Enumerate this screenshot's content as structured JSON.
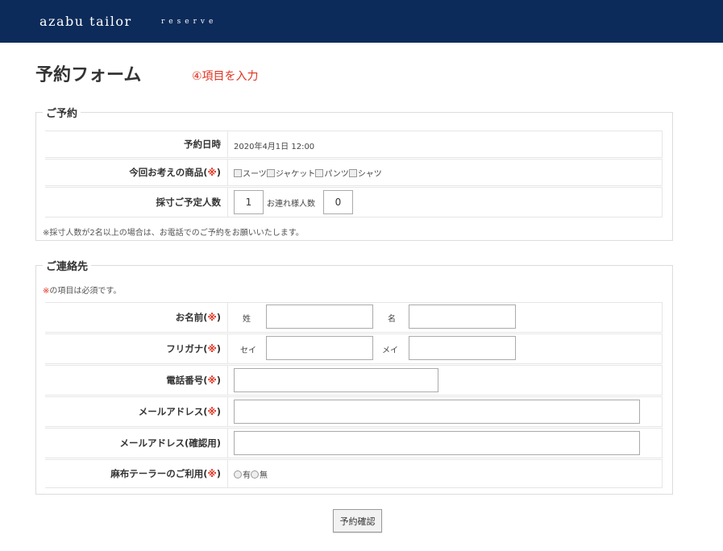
{
  "header": {
    "brand": "azabu tailor",
    "tagline": "reserve"
  },
  "page": {
    "title": "予約フォーム",
    "step_note": "④項目を入力"
  },
  "reservation": {
    "legend": "ご予約",
    "date_label": "予約日時",
    "date_value": "2020年4月1日 12:00",
    "products_label": "今回お考えの商品",
    "products": [
      "スーツ",
      "ジャケット",
      "パンツ",
      "シャツ"
    ],
    "count_label": "採寸ご予定人数",
    "count_value": "1",
    "companions_label": "お連れ様人数",
    "companions_value": "0",
    "note": "※採寸人数が2名以上の場合は、お電話でのご予約をお願いいたします。"
  },
  "contact": {
    "legend": "ご連絡先",
    "required_mark": "※",
    "required_note": "の項目は必須です。",
    "name_label": "お名前",
    "sei_label": "姓",
    "mei_label": "名",
    "kana_label": "フリガナ",
    "kana_sei_label": "セイ",
    "kana_mei_label": "メイ",
    "phone_label": "電話番号",
    "email_label": "メールアドレス",
    "email_confirm_label": "メールアドレス(確認用)",
    "usage_label": "麻布テーラーのご利用",
    "usage_options": [
      "有",
      "無"
    ]
  },
  "req": {
    "open": "(",
    "mark": "※",
    "close": ")"
  },
  "submit_label": "予約確認"
}
